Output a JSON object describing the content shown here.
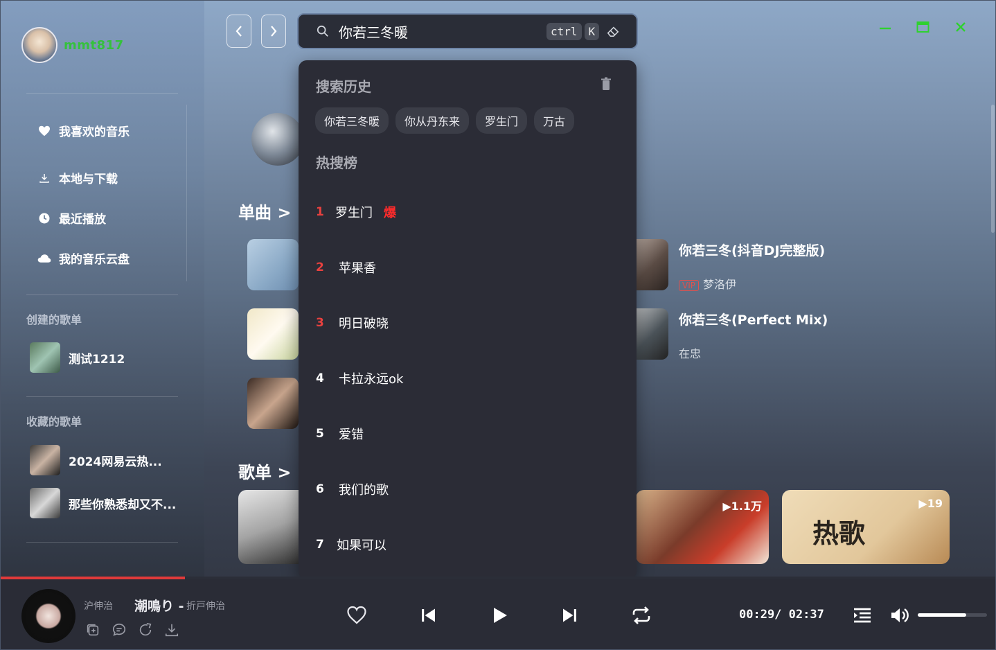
{
  "user": {
    "name": "mmt817"
  },
  "sidebar": {
    "nav": [
      {
        "label": "我喜欢的音乐",
        "icon": "heart-icon"
      },
      {
        "label": "本地与下载",
        "icon": "download-icon"
      },
      {
        "label": "最近播放",
        "icon": "clock-icon"
      },
      {
        "label": "我的音乐云盘",
        "icon": "cloud-icon"
      }
    ],
    "created_title": "创建的歌单",
    "created": [
      {
        "label": "测试1212"
      }
    ],
    "collected_title": "收藏的歌单",
    "collected": [
      {
        "label": "2024网易云热..."
      },
      {
        "label": "那些你熟悉却又不..."
      }
    ]
  },
  "search": {
    "value": "你若三冬暖",
    "kbd1": "ctrl",
    "kbd2": "K"
  },
  "dropdown": {
    "history_title": "搜索历史",
    "history": [
      "你若三冬暖",
      "你从丹东来",
      "罗生门",
      "万古"
    ],
    "hot_title": "热搜榜",
    "hot": [
      {
        "rank": "1",
        "title": "罗生门",
        "badge": "爆"
      },
      {
        "rank": "2",
        "title": "苹果香",
        "badge": ""
      },
      {
        "rank": "3",
        "title": "明日破晓",
        "badge": ""
      },
      {
        "rank": "4",
        "title": "卡拉永远ok",
        "badge": ""
      },
      {
        "rank": "5",
        "title": "爱错",
        "badge": ""
      },
      {
        "rank": "6",
        "title": "我们的歌",
        "badge": ""
      },
      {
        "rank": "7",
        "title": "如果可以",
        "badge": ""
      }
    ]
  },
  "main": {
    "singles_title": "单曲 >",
    "playlists_title": "歌单 >",
    "songs": [
      {
        "title": "你若三冬(抖音DJ完整版)",
        "vip": "VIP",
        "artist": "梦洛伊"
      },
      {
        "title": "你若三冬(Perfect Mix)",
        "vip": "",
        "artist": "在忠"
      }
    ],
    "cards": [
      {
        "count": "▶1.1万"
      },
      {
        "count": "▶19",
        "text": "热歌"
      }
    ]
  },
  "player": {
    "artist_prev": "沪伸治",
    "title": "潮鳴り",
    "separator": " - ",
    "artist": "折戸伸治",
    "time": "00:29/ 02:37",
    "progress": 0.185,
    "volume": 0.7
  },
  "colors": {
    "accent_green": "#2fd12f",
    "accent_red": "#e03a3a",
    "dropdown_bg": "#2b2c36"
  }
}
